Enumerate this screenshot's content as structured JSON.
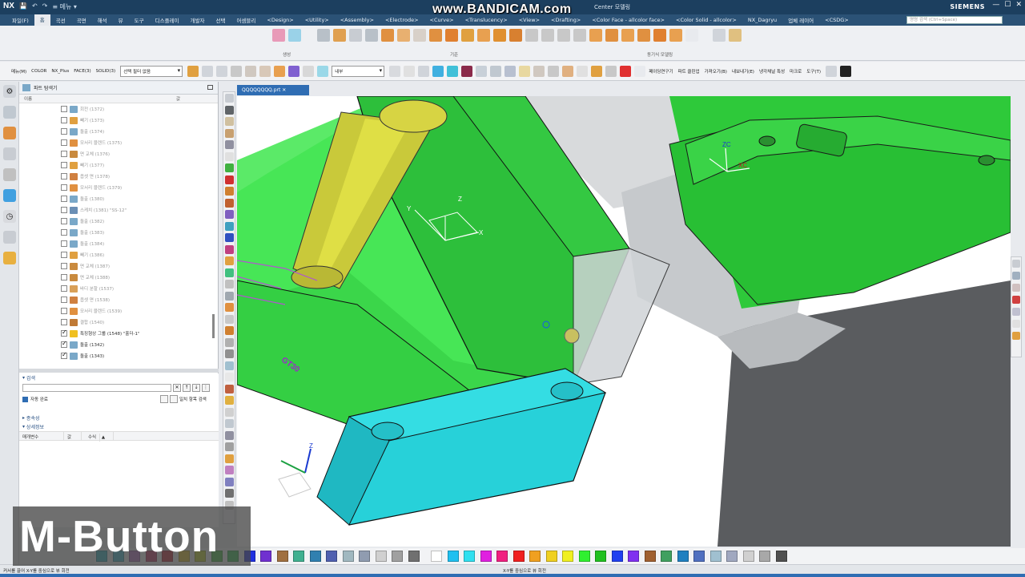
{
  "watermark": "www.BANDICAM.com",
  "titlebar": {
    "app_logo": "NX",
    "title": "Center 모델링",
    "brand": "SIEMENS",
    "quick_access": [
      "💾",
      "↶",
      "↷",
      "≡ 메뉴 ▾"
    ],
    "window_buttons": [
      "—",
      "☐",
      "✕"
    ]
  },
  "menu": {
    "tabs": [
      "파일(F)",
      "홈",
      "곡선",
      "곡면",
      "해석",
      "뷰",
      "도구",
      "디스플레이",
      "개발자",
      "선택",
      "어셈블리",
      "<Design>",
      "<Utility>",
      "<Assembly>",
      "<Electrode>",
      "<Curve>",
      "<Translucency>",
      "<View>",
      "<Drafting>",
      "<Color Face - allcolor face>",
      "<Color Solid - allcolor>",
      "NX_Dagryu",
      "업체 레이어",
      "<CSDG>"
    ],
    "active_tab_index": 1,
    "search_placeholder": "명령 검색 (Ctrl+Space)"
  },
  "ribbon": {
    "group_labels": [
      "생성",
      "기준",
      "동기식 모델링"
    ]
  },
  "toolbar": {
    "menu_label": "메뉴(M)",
    "color_label": "COLOR",
    "nxplus_label": "NX_Plus",
    "face_label": "FACE(3)",
    "solid_label": "SOLID(3)",
    "filter_value": "선택 필터 없음",
    "assembly_scope": "내부",
    "right_items": [
      "페이딩연구기",
      "파트 클린업",
      "가져오기(B)",
      "내보내기(E)",
      "냉각채널 특성",
      "마크로",
      "도구(T)"
    ]
  },
  "navigator": {
    "title": "파트 탐색기",
    "col_name": "이름",
    "col_value": "값",
    "items": [
      {
        "label": "회전 (1372)",
        "checked": false,
        "icon_color": "#7aa8c8"
      },
      {
        "label": "빼기 (1373)",
        "checked": false,
        "icon_color": "#e0a040"
      },
      {
        "label": "돌출 (1374)",
        "checked": false,
        "icon_color": "#7aa8c8"
      },
      {
        "label": "모서리 블렌드 (1375)",
        "checked": false,
        "icon_color": "#e09040"
      },
      {
        "label": "면 교체 (1376)",
        "checked": false,
        "icon_color": "#c98a3e"
      },
      {
        "label": "빼기 (1377)",
        "checked": false,
        "icon_color": "#e0a040"
      },
      {
        "label": "옵셋 면 (1378)",
        "checked": false,
        "icon_color": "#d08040"
      },
      {
        "label": "모서리 블렌드 (1379)",
        "checked": false,
        "icon_color": "#e09040"
      },
      {
        "label": "돌출 (1380)",
        "checked": false,
        "icon_color": "#7aa8c8"
      },
      {
        "label": "스케치 (1381) \"SS-12\"",
        "checked": false,
        "icon_color": "#6b8fb5"
      },
      {
        "label": "돌출 (1382)",
        "checked": false,
        "icon_color": "#7aa8c8"
      },
      {
        "label": "돌출 (1383)",
        "checked": false,
        "icon_color": "#7aa8c8"
      },
      {
        "label": "돌출 (1384)",
        "checked": false,
        "icon_color": "#7aa8c8"
      },
      {
        "label": "빼기 (1386)",
        "checked": false,
        "icon_color": "#e0a040"
      },
      {
        "label": "면 교체 (1387)",
        "checked": false,
        "icon_color": "#c98a3e"
      },
      {
        "label": "면 교체 (1388)",
        "checked": false,
        "icon_color": "#c98a3e"
      },
      {
        "label": "바디 분할 (1537)",
        "checked": false,
        "icon_color": "#d9a058"
      },
      {
        "label": "옵셋 면 (1538)",
        "checked": false,
        "icon_color": "#d08040"
      },
      {
        "label": "모서리 블렌드 (1539)",
        "checked": false,
        "icon_color": "#e09040"
      },
      {
        "label": "결합 (1540)",
        "checked": false,
        "icon_color": "#c07a36"
      },
      {
        "label": "특징형상 그룹 (1548) \"홀더-1\"",
        "checked": true,
        "icon_color": "#f0c020"
      },
      {
        "label": "돌출 (1342)",
        "checked": true,
        "icon_color": "#7aa8c8"
      },
      {
        "label": "돌출 (1343)",
        "checked": true,
        "icon_color": "#7aa8c8"
      }
    ]
  },
  "search_panel": {
    "title": "검색",
    "auto_complete_label": "자동 완료",
    "match_all_label": "일치 항목 검색"
  },
  "dependencies": {
    "title": "종속성"
  },
  "details": {
    "title": "상세정보",
    "columns": [
      "매개변수",
      "값",
      "수식"
    ]
  },
  "document_tab": {
    "label": "QQQQQQQQ.prt"
  },
  "viewport": {
    "part_label": "GT30",
    "wcs_labels": [
      "ZC",
      "XC"
    ],
    "view_axis_labels": [
      "Z",
      "Y",
      "X"
    ],
    "csys_labels": [
      "Z"
    ]
  },
  "palette": {
    "colors": [
      "#2ab0c0",
      "#3cbcd0",
      "#b070c0",
      "#c03060",
      "#c02030",
      "#e0c020",
      "#c0d020",
      "#40c040",
      "#30c050",
      "#2030e0",
      "#7030d0",
      "#a07040",
      "#40b090",
      "#3080b0",
      "#5060b0",
      "#a0b8c0",
      "#909cb0",
      "#d0d0d0",
      "#a0a0a0",
      "#707070",
      "#ffffff",
      "#20c0f0",
      "#30e0f0",
      "#e020e0",
      "#f02080",
      "#f02020",
      "#f0a020",
      "#f0d020",
      "#f0f020",
      "#30f030",
      "#20c020",
      "#2040f0",
      "#8030f0",
      "#a06030",
      "#40a060",
      "#2080c0",
      "#5070c0",
      "#a0c0d0",
      "#a0a8c0",
      "#d0d0d0",
      "#a8a8a8",
      "#505050"
    ]
  },
  "status": {
    "left": "커서를 끌어 X-Y를 중심으로 뷰 회전",
    "center": "X-Y를 중심으로 뷰 회전"
  },
  "caption": "M-Button"
}
